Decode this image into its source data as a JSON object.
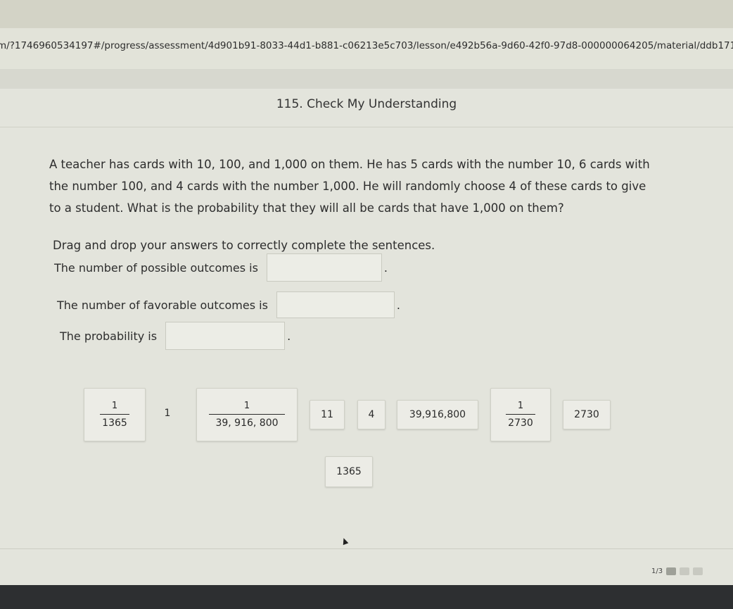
{
  "browser": {
    "url": "m/?1746960534197#/progress/assessment/4d901b91-8033-44d1-b881-c06213e5c703/lesson/e492b56a-9d60-42f0-97d8-000000064205/material/ddb171dd-44"
  },
  "page": {
    "title": "115. Check My Understanding"
  },
  "question": {
    "text": "A teacher has cards with 10, 100, and 1,000 on them. He has 5 cards with the number 10, 6 cards with the number 100, and 4 cards with the number 1,000. He will randomly choose 4 of these cards to give to a student. What is the probability that they will all be cards that have 1,000 on them?",
    "instruction": "Drag and drop your answers to correctly complete the sentences."
  },
  "sentences": {
    "possible": "The number of possible outcomes is",
    "favorable": "The number of favorable outcomes is",
    "probability": "The probability is",
    "end": "."
  },
  "tiles": {
    "frac_1365": {
      "num": "1",
      "den": "1365"
    },
    "one": "1",
    "frac_39916800": {
      "num": "1",
      "den": "39, 916, 800"
    },
    "eleven": "11",
    "four": "4",
    "big": "39,916,800",
    "frac_2730": {
      "num": "1",
      "den": "2730"
    },
    "n2730": "2730",
    "n1365": "1365"
  },
  "pager": {
    "label": "1/3"
  }
}
